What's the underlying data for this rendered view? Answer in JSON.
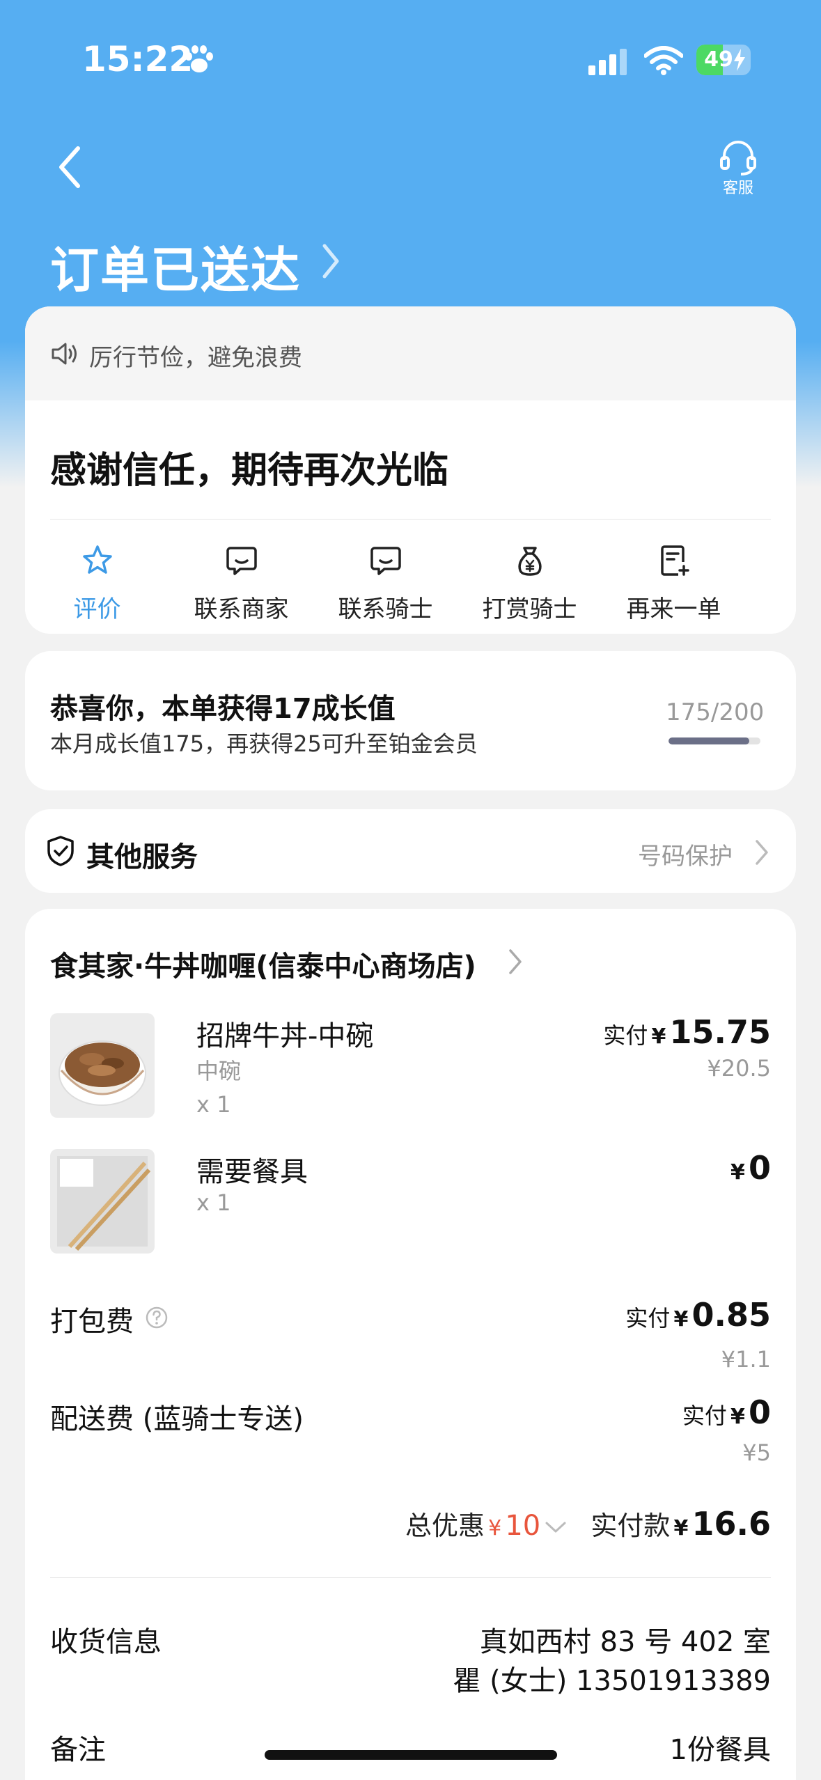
{
  "status_bar": {
    "time": "15:22",
    "battery": "49",
    "battery_level": 0.49
  },
  "nav": {
    "service_label": "客服"
  },
  "order": {
    "title": "订单已送达"
  },
  "notice": {
    "text": "厉行节俭，避免浪费"
  },
  "thanks": {
    "text": "感谢信任，期待再次光临"
  },
  "actions": [
    {
      "label": "评价",
      "icon": "star-icon",
      "active": true
    },
    {
      "label": "联系商家",
      "icon": "chat-icon"
    },
    {
      "label": "联系骑士",
      "icon": "chat-icon"
    },
    {
      "label": "打赏骑士",
      "icon": "money-bag-icon"
    },
    {
      "label": "再来一单",
      "icon": "reorder-icon"
    }
  ],
  "growth": {
    "title": "恭喜你，本单获得17成长值",
    "subtitle": "本月成长值175，再获得25可升至铂金会员",
    "progress_text": "175/200",
    "progress": 0.875
  },
  "services": {
    "title": "其他服务",
    "link": "号码保护"
  },
  "store": {
    "name": "食其家·牛丼咖喱(信泰中心商场店)"
  },
  "items": [
    {
      "name": "招牌牛丼-中碗",
      "spec": "中碗",
      "qty": "x 1",
      "paid_label": "实付",
      "yen": "¥",
      "price": "15.75",
      "original": "¥20.5"
    },
    {
      "name": "需要餐具",
      "qty": "x 1",
      "yen": "¥",
      "price": "0",
      "img_label": "食其家\n餐具"
    }
  ],
  "fees": {
    "packing": {
      "label": "打包费",
      "paid_label": "实付",
      "yen": "¥",
      "price": "0.85",
      "original": "¥1.1"
    },
    "delivery": {
      "label": "配送费 (蓝骑士专送)",
      "paid_label": "实付",
      "yen": "¥",
      "price": "0",
      "original": "¥5"
    }
  },
  "totals": {
    "discount_label": "总优惠",
    "discount_yen": "¥",
    "discount": "10",
    "paid_label": "实付款",
    "paid_yen": "¥",
    "paid": "16.6"
  },
  "delivery_info": {
    "label": "收货信息",
    "address": "真如西村 83 号 402 室",
    "contact": "瞿 (女士) 13501913389"
  },
  "remark": {
    "label": "备注",
    "value": "1份餐具"
  },
  "colors": {
    "hero": "#56aef2",
    "accent": "#3d9ae6",
    "discount": "#e8553c"
  }
}
